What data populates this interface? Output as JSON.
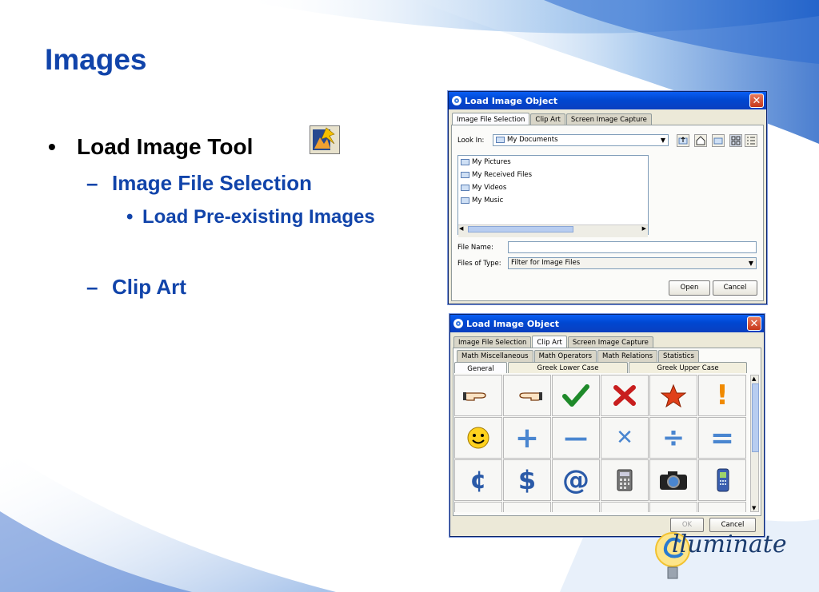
{
  "slide": {
    "title": "Images",
    "bullets": {
      "b1": "Load Image Tool",
      "b1_bullet": "•",
      "b2a": "Image File Selection",
      "b2a_dash": "–",
      "b3": "Load Pre-existing Images",
      "b3_bullet": "•",
      "b2b": "Clip Art",
      "b2b_dash": "–"
    },
    "logo": "lluminate"
  },
  "dialog1": {
    "title": "Load Image Object",
    "close": "✕",
    "tabs": [
      "Image File Selection",
      "Clip Art",
      "Screen Image Capture"
    ],
    "look_in_label": "Look In:",
    "look_in_value": "My Documents",
    "files": [
      "My Pictures",
      "My Received Files",
      "My Videos",
      "My Music"
    ],
    "file_name_label": "File Name:",
    "file_name_value": "",
    "files_of_type_label": "Files of Type:",
    "files_of_type_value": "Filter for Image Files",
    "open": "Open",
    "cancel": "Cancel",
    "arrow_down": "▼",
    "arrow_left": "◀",
    "arrow_right": "▶"
  },
  "dialog2": {
    "title": "Load Image Object",
    "close": "✕",
    "tabs": [
      "Image File Selection",
      "Clip Art",
      "Screen Image Capture"
    ],
    "subtabs_row1": [
      "Math Miscellaneous",
      "Math Operators",
      "Math Relations",
      "Statistics"
    ],
    "subtabs_row2": [
      "General",
      "Greek Lower Case",
      "Greek Upper Case"
    ],
    "glyphs": {
      "exclaim": "!",
      "plus": "+",
      "minus": "—",
      "times": "✕",
      "divide": "÷",
      "equals": "=",
      "cent": "¢",
      "dollar": "$",
      "at": "@"
    },
    "ok": "OK",
    "cancel": "Cancel",
    "arrow_up": "▲",
    "arrow_down": "▼"
  }
}
